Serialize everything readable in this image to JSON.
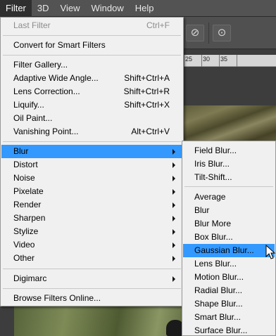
{
  "menubar": {
    "items": [
      "Filter",
      "3D",
      "View",
      "Window",
      "Help"
    ]
  },
  "ruler": {
    "ticks": [
      "25",
      "30",
      "35"
    ]
  },
  "filter_menu": {
    "last_filter": {
      "label": "Last Filter",
      "shortcut": "Ctrl+F"
    },
    "convert_smart": "Convert for Smart Filters",
    "gallery_group": [
      {
        "label": "Filter Gallery...",
        "shortcut": ""
      },
      {
        "label": "Adaptive Wide Angle...",
        "shortcut": "Shift+Ctrl+A"
      },
      {
        "label": "Lens Correction...",
        "shortcut": "Shift+Ctrl+R"
      },
      {
        "label": "Liquify...",
        "shortcut": "Shift+Ctrl+X"
      },
      {
        "label": "Oil Paint...",
        "shortcut": ""
      },
      {
        "label": "Vanishing Point...",
        "shortcut": "Alt+Ctrl+V"
      }
    ],
    "submenus": [
      "Blur",
      "Distort",
      "Noise",
      "Pixelate",
      "Render",
      "Sharpen",
      "Stylize",
      "Video",
      "Other"
    ],
    "digimarc": "Digimarc",
    "browse_online": "Browse Filters Online..."
  },
  "blur_submenu": {
    "group1": [
      "Field Blur...",
      "Iris Blur...",
      "Tilt-Shift..."
    ],
    "group2": [
      "Average",
      "Blur",
      "Blur More",
      "Box Blur...",
      "Gaussian Blur...",
      "Lens Blur...",
      "Motion Blur...",
      "Radial Blur...",
      "Shape Blur...",
      "Smart Blur...",
      "Surface Blur..."
    ]
  },
  "colors": {
    "highlight": "#3399ff",
    "menu_bg": "#f0f0f0",
    "menubar_bg": "#535353",
    "disabled_text": "#8c8c8c"
  }
}
